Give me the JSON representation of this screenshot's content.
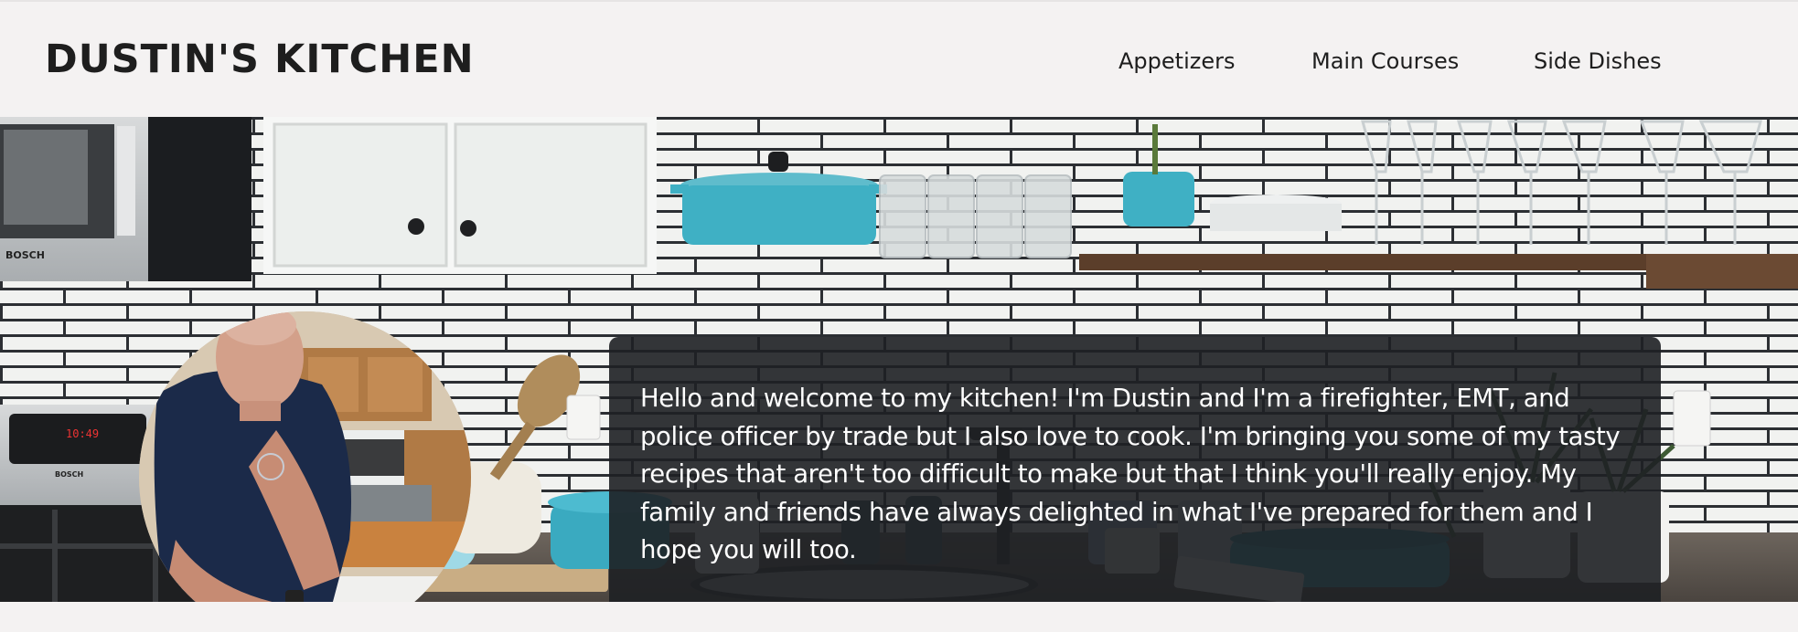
{
  "header": {
    "brand": "DUSTIN'S KITCHEN",
    "nav": [
      {
        "label": "Appetizers"
      },
      {
        "label": "Main Courses"
      },
      {
        "label": "Side Dishes"
      }
    ]
  },
  "hero": {
    "welcome_text": "Hello and welcome to my kitchen! I'm Dustin and I'm a firefighter, EMT, and police officer by trade but I also love to cook. I'm bringing you some of my tasty recipes that aren't too difficult to make but that I think you'll really enjoy. My family and friends have always delighted in what I've prepared for them and I hope you will too.",
    "microwave_brand": "BOSCH",
    "oven_brand": "BOSCH",
    "oven_clock": "10:49"
  },
  "colors": {
    "page_background": "#f4f2f2",
    "text_dark": "#1e1e1e",
    "overlay": "#1e2024",
    "teal_cookware": "#3fb0c4"
  }
}
